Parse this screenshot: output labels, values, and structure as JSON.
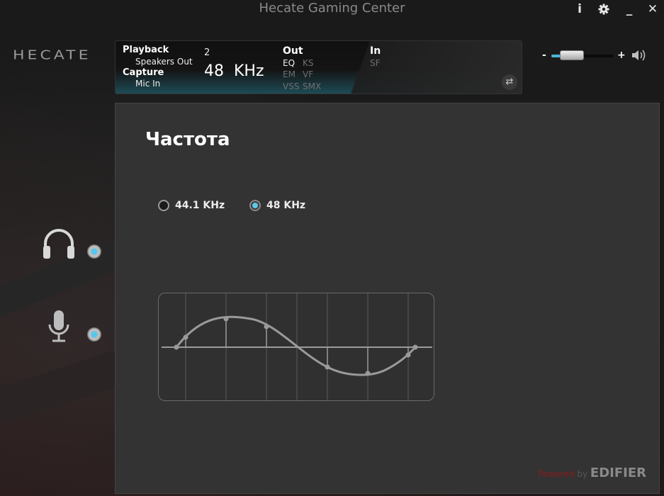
{
  "window": {
    "title": "Hecate Gaming Center",
    "buttons": {
      "info": "i",
      "settings": "⚙",
      "minimize": "_",
      "close": "✕"
    }
  },
  "logo": "HECATE",
  "info_panel": {
    "playback_label": "Playback",
    "playback_device": "Speakers Out",
    "capture_label": "Capture",
    "capture_device": "Mic In",
    "channels": "2",
    "sample_rate": "48  KHz",
    "out_label": "Out",
    "out_items": [
      "EQ",
      "KS",
      "EM",
      "VF",
      "VSS",
      "SMX"
    ],
    "in_label": "In",
    "in_items": [
      "SF"
    ]
  },
  "volume": {
    "minus": "-",
    "plus": "+",
    "level": 0.2
  },
  "main": {
    "section_title": "Частота",
    "options": [
      {
        "label": "44.1 KHz",
        "selected": false
      },
      {
        "label": "48 KHz",
        "selected": true
      }
    ]
  },
  "footer": {
    "powered": "Powered",
    "by": "by",
    "brand": "EDIFIER"
  },
  "icons": {
    "headphones": "headphones-icon",
    "microphone": "microphone-icon",
    "speaker": "speaker-icon",
    "swap": "swap-icon"
  },
  "colors": {
    "accent": "#5ec8ea",
    "panel": "#333333",
    "background": "#1c1c1c"
  }
}
